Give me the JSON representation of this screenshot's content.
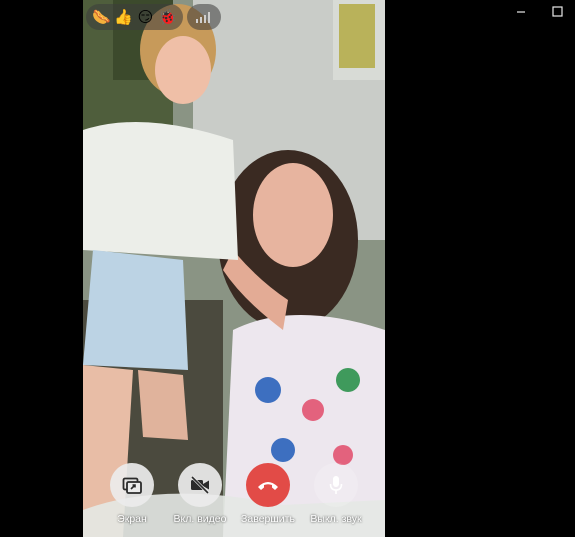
{
  "window": {
    "controls": [
      "minimize",
      "maximize"
    ]
  },
  "reactions": {
    "emojis": [
      {
        "name": "sausage",
        "glyph": "🌭"
      },
      {
        "name": "thumbs-up",
        "glyph": "👍"
      },
      {
        "name": "smirk",
        "glyph": "😏"
      },
      {
        "name": "ladybug",
        "glyph": "🐞"
      }
    ],
    "signal_icon": "signal-strength-icon"
  },
  "call_controls": {
    "screen_label": "Экран",
    "video_label": "Вкл. видео",
    "end_label": "Завершить",
    "mute_label": "Выкл. звук"
  },
  "colors": {
    "end_call": "#e24b47",
    "button_light": "#ebebeb"
  }
}
